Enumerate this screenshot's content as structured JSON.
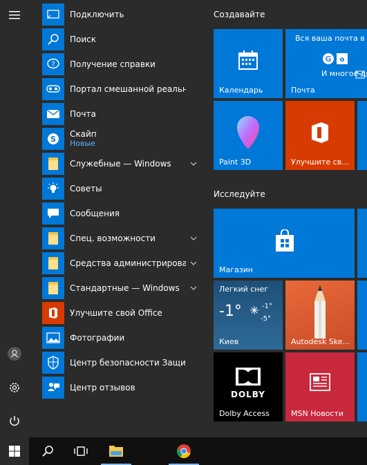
{
  "apps": [
    {
      "label": "Подключить",
      "icon": "connect-icon"
    },
    {
      "label": "Поиск",
      "icon": "search-icon"
    },
    {
      "label": "Получение справки",
      "icon": "help-icon"
    },
    {
      "label": "Портал смешанной реальности",
      "icon": "mixed-reality-icon"
    },
    {
      "label": "Почта",
      "icon": "mail-icon"
    },
    {
      "label": "Скайп",
      "sub": "Новые",
      "icon": "skype-icon"
    },
    {
      "label": "Служебные — Windows",
      "icon": "folder-icon",
      "expandable": true
    },
    {
      "label": "Советы",
      "icon": "tips-icon"
    },
    {
      "label": "Сообщения",
      "icon": "messaging-icon"
    },
    {
      "label": "Спец. возможности",
      "icon": "folder-icon",
      "expandable": true
    },
    {
      "label": "Средства администрировани...",
      "icon": "folder-icon",
      "expandable": true
    },
    {
      "label": "Стандартные — Windows",
      "icon": "folder-icon",
      "expandable": true
    },
    {
      "label": "Улучшите свой Office",
      "icon": "office-icon"
    },
    {
      "label": "Фотографии",
      "icon": "photos-icon"
    },
    {
      "label": "Центр безопасности Защитника...",
      "icon": "shield-icon"
    },
    {
      "label": "Центр отзывов",
      "icon": "feedback-icon"
    }
  ],
  "groups": {
    "create": "Создавайте",
    "explore": "Исследуйте"
  },
  "tiles": {
    "calendar": "Календарь",
    "mail": "Почта",
    "mail_heading": "Вся ваша почта в одном",
    "mail_more": "И многое другое",
    "paint3d": "Paint 3D",
    "office": "Улучшите св...",
    "store": "Магазин",
    "weather_condition": "Легкий снег",
    "weather_temp": "-1°",
    "weather_high": "-1°",
    "weather_low": "-5°",
    "weather_city": "Киев",
    "autodesk": "Autodesk Ske...",
    "dolby": "Dolby Access",
    "dolby_logo": "DOLBY",
    "msn": "MSN Новости"
  },
  "colors": {
    "accent": "#0078d7",
    "office": "#d83b01",
    "msn": "#c8283c",
    "dolby": "#000000"
  }
}
